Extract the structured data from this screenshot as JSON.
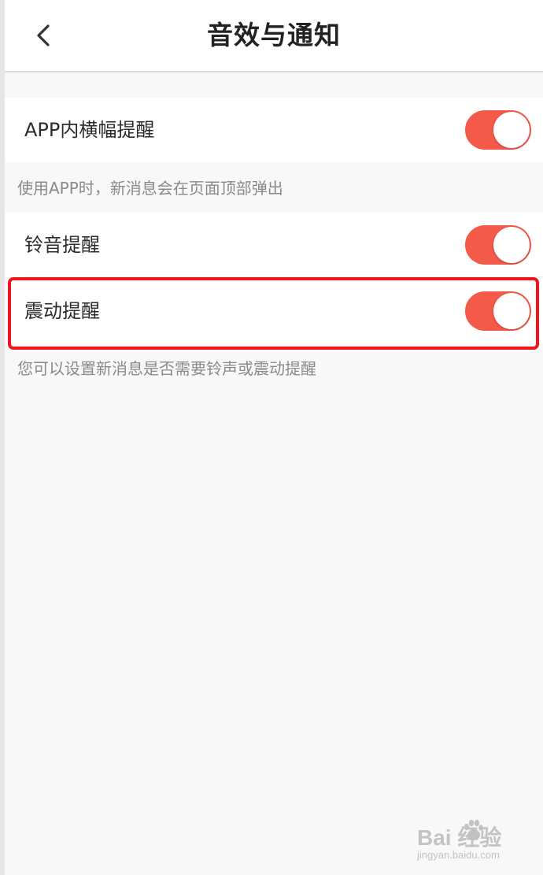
{
  "header": {
    "title": "音效与通知",
    "back_icon": "chevron-left-icon"
  },
  "settings": [
    {
      "label": "APP内横幅提醒",
      "enabled": true
    },
    {
      "label": "铃音提醒",
      "enabled": true
    },
    {
      "label": "震动提醒",
      "enabled": true
    }
  ],
  "hints": [
    "使用APP时，新消息会在页面顶部弹出",
    "您可以设置新消息是否需要铃声或震动提醒"
  ],
  "watermark": {
    "main": "Bai  经验",
    "sub": "jingyan.baidu.com"
  },
  "colors": {
    "toggle_on": "#f35a4a",
    "highlight": "#f0151a",
    "background": "#f8f8f8"
  }
}
